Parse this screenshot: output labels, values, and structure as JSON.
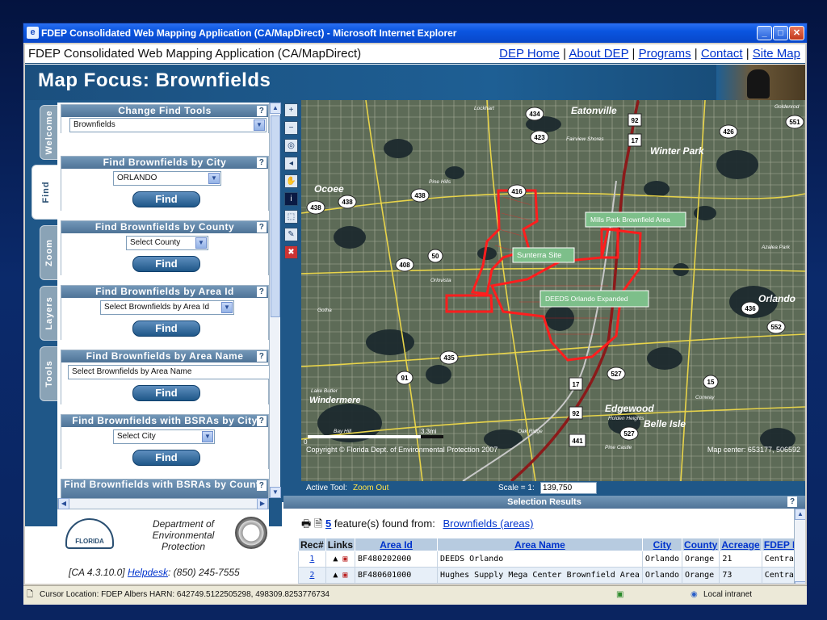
{
  "window": {
    "title": "FDEP Consolidated Web Mapping Application (CA/MapDirect) - Microsoft Internet Explorer",
    "min_glyph": "_",
    "max_glyph": "□",
    "close_glyph": "✕"
  },
  "topbar": {
    "app_title": "FDEP Consolidated Web Mapping Application (CA/MapDirect)",
    "links": [
      "DEP Home",
      "About DEP",
      "Programs",
      "Contact",
      "Site Map"
    ],
    "separator": "|"
  },
  "header": {
    "title": "Map Focus: Brownfields"
  },
  "side_tabs": [
    "Welcome",
    "Find",
    "Zoom",
    "Layers",
    "Tools"
  ],
  "active_tab": "Find",
  "find_tools": [
    {
      "heading": "Change Find Tools",
      "select": "Brownfields"
    },
    {
      "heading": "Find Brownfields by City",
      "select": "ORLANDO",
      "button": "Find"
    },
    {
      "heading": "Find Brownfields by County",
      "select": "Select County",
      "button": "Find"
    },
    {
      "heading": "Find Brownfields by Area Id",
      "select": "Select Brownfields by Area Id",
      "button": "Find"
    },
    {
      "heading": "Find Brownfields by Area Name",
      "select": "Select Brownfields by Area Name",
      "button": "Find"
    },
    {
      "heading": "Find Brownfields with BSRAs by City",
      "select": "Select City",
      "button": "Find"
    },
    {
      "heading": "Find Brownfields with BSRAs by County"
    }
  ],
  "help_label": "?",
  "dep": {
    "logo_text": "FLORIDA",
    "name_line1": "Department of",
    "name_line2": "Environmental",
    "name_line3": "Protection",
    "version": "[CA 4.3.10.0]",
    "helpdesk_label": "Helpdesk",
    "helpdesk_phone": ": (850) 245-7555"
  },
  "map": {
    "labels": {
      "eatonville": "Eatonville",
      "winter_park": "Winter Park",
      "ocoee": "Ocoee",
      "orlando": "Orlando",
      "edgewood": "Edgewood",
      "belle_isle": "Belle Isle",
      "windermere": "Windermere",
      "lockhart": "Lockhart",
      "goldenrod": "Goldenrod",
      "fairview_shores": "Fairview Shores",
      "pine_hills": "Pine Hills",
      "orlovista": "Orlovista",
      "gotha": "Gotha",
      "lake_butler": "Lake Butler",
      "azalea_park": "Azalea Park",
      "conway": "Conway",
      "holden_heights": "Holden Heights",
      "oak_ridge": "Oak Ridge",
      "bay_hill": "Bay Hill",
      "pine_castle": "Pine Castle"
    },
    "callouts": {
      "mills_park": "Mills Park Brownfield Area",
      "sunterra": "Sunterra Site",
      "deeds": "DEEDS Orlando Expanded"
    },
    "route_shields": {
      "r434": "434",
      "r92a": "92",
      "r423": "423",
      "r17a": "17",
      "r426": "426",
      "r551": "551",
      "r416": "416",
      "r438a": "438",
      "r438b": "438",
      "r438c": "438",
      "r50": "50",
      "r408": "408",
      "r436": "436",
      "r552": "552",
      "r435": "435",
      "r91": "91",
      "r17b": "17",
      "r527a": "527",
      "r15": "15",
      "r92b": "92",
      "r527b": "527",
      "r441": "441"
    },
    "scale_start": "0",
    "scale_end": "3.3mi",
    "copyright": "Copyright © Florida Dept. of Environmental Protection 2007",
    "map_center": "Map center: 653177, 506592",
    "active_tool_label": "Active Tool:",
    "active_tool": "Zoom Out",
    "scale_label": "Scale = 1:",
    "scale_value": "139,750"
  },
  "map_tools": [
    "zoom-in",
    "zoom-out",
    "zoom-full",
    "zoom-previous",
    "pan",
    "identify",
    "select",
    "measure",
    "clear"
  ],
  "results": {
    "title": "Selection Results",
    "count": "5",
    "found_text": "feature(s) found from:",
    "source_link": "Brownfields (areas)",
    "columns": [
      "Rec#",
      "Links",
      "Area Id",
      "Area Name",
      "City",
      "County",
      "Acreage",
      "FDEP D"
    ],
    "rows": [
      {
        "rec": "1",
        "area_id": "BF480202000",
        "area_name": "DEEDS Orlando",
        "city": "Orlando",
        "county": "Orange",
        "acreage": "21",
        "district": "Central"
      },
      {
        "rec": "2",
        "area_id": "BF480601000",
        "area_name": "Hughes Supply Mega Center Brownfield Area",
        "city": "Orlando",
        "county": "Orange",
        "acreage": "73",
        "district": "Central"
      }
    ]
  },
  "status": {
    "cursor": "Cursor Location: FDEP Albers HARN: 642749.5122505298, 498309.8253776734",
    "zone": "Local intranet"
  }
}
